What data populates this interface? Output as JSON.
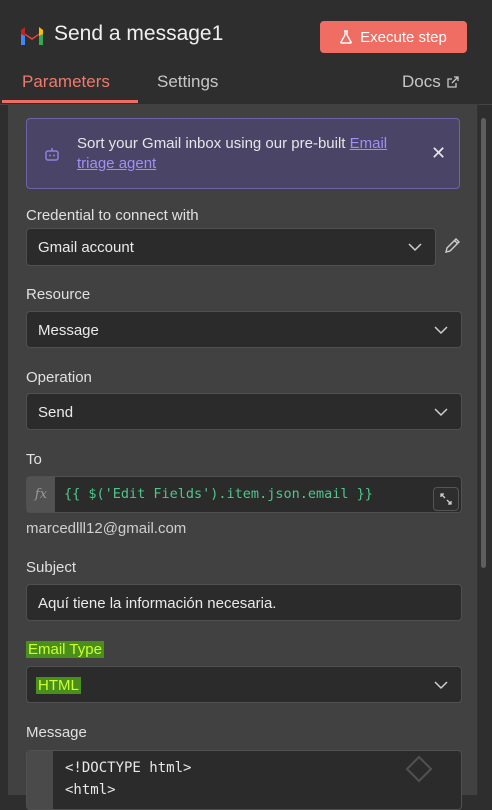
{
  "header": {
    "title": "Send a message1",
    "execute_label": "Execute step"
  },
  "tabs": {
    "parameters": "Parameters",
    "settings": "Settings",
    "docs": "Docs"
  },
  "banner": {
    "text": "Sort your Gmail inbox using our pre-built ",
    "link": "Email triage agent"
  },
  "credential": {
    "label": "Credential to connect with",
    "value": "Gmail account"
  },
  "resource": {
    "label": "Resource",
    "value": "Message"
  },
  "operation": {
    "label": "Operation",
    "value": "Send"
  },
  "to": {
    "label": "To",
    "fx": "fx",
    "expression": "{{ $('Edit Fields').item.json.email }}",
    "preview": "marcedlll12@gmail.com"
  },
  "subject": {
    "label": "Subject",
    "value": "Aquí tiene la información necesaria."
  },
  "email_type": {
    "label": "Email Type",
    "value": "HTML"
  },
  "message": {
    "label": "Message",
    "lines": [
      "<!DOCTYPE html>",
      "<html>"
    ]
  },
  "colors": {
    "accent": "#ef6d62",
    "expression_green": "#4ec78a",
    "highlight_bg": "#4b8f1b",
    "highlight_text": "#ccff33",
    "banner_bg": "#4a4567",
    "banner_link": "#a18ff2"
  },
  "icons": [
    "gmail-logo-icon",
    "flask-icon",
    "external-link-icon",
    "robot-icon",
    "close-icon",
    "chevron-down-icon",
    "pencil-icon",
    "expand-icon"
  ]
}
